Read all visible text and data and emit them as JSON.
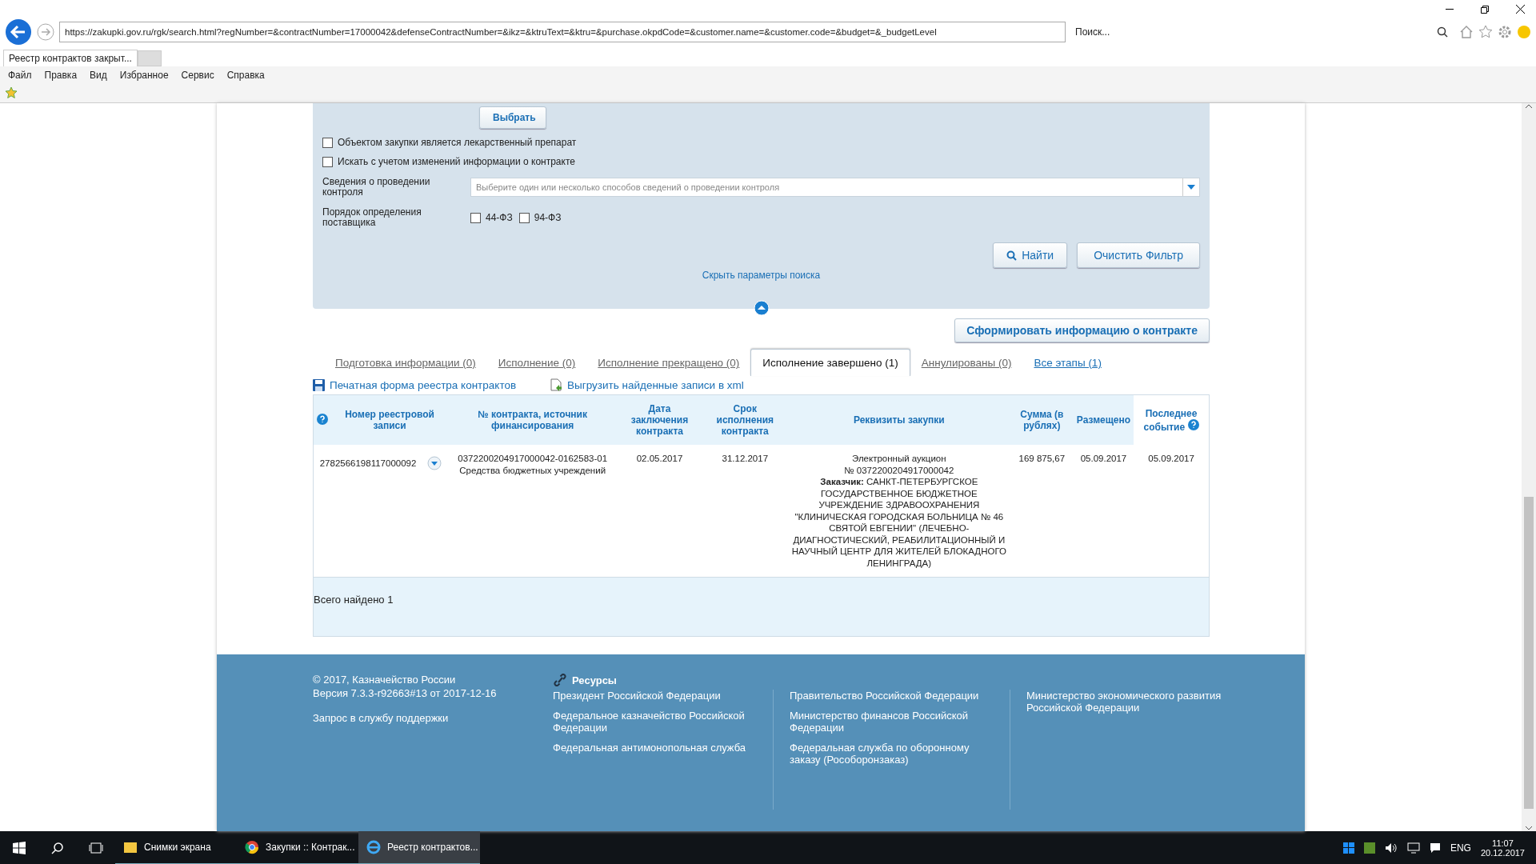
{
  "browser": {
    "url": "https://zakupki.gov.ru/rgk/search.html?regNumber=&contractNumber=17000042&defenseContractNumber=&ikz=&ktruText=&ktru=&purchase.okpdCode=&customer.name=&customer.code=&budget=&_budgetLevel",
    "search_placeholder": "Поиск...",
    "tab_title": "Реестр контрактов закрыт...",
    "menu": [
      "Файл",
      "Правка",
      "Вид",
      "Избранное",
      "Сервис",
      "Справка"
    ]
  },
  "filter": {
    "choose_button": "Выбрать",
    "checkboxes": [
      {
        "label": "Объектом закупки является лекарственный препарат",
        "checked": false
      },
      {
        "label": "Искать с учетом изменений информации о контракте",
        "checked": false
      }
    ],
    "control_label": "Сведения о проведении контроля",
    "control_placeholder": "Выберите один или несколько способов сведений о проведении контроля",
    "supplier_label": "Порядок определения поставщика",
    "supplier_options": [
      {
        "label": "44-ФЗ",
        "checked": false
      },
      {
        "label": "94-ФЗ",
        "checked": false
      }
    ],
    "find_button": "Найти",
    "clear_button": "Очистить Фильтр",
    "hide_link": "Скрыть параметры поиска"
  },
  "generate_button": "Сформировать информацию о контракте",
  "tabs": [
    {
      "label": "Подготовка информации (0)",
      "selected": false,
      "kind": "plain"
    },
    {
      "label": "Исполнение (0)",
      "selected": false,
      "kind": "plain"
    },
    {
      "label": "Исполнение прекращено (0)",
      "selected": false,
      "kind": "plain"
    },
    {
      "label": "Исполнение завершено (1)",
      "selected": true,
      "kind": "plain"
    },
    {
      "label": "Аннулированы (0)",
      "selected": false,
      "kind": "plain"
    },
    {
      "label": "Все этапы (1)",
      "selected": false,
      "kind": "link"
    }
  ],
  "print_link": "Печатная форма реестра контрактов",
  "export_link": "Выгрузить найденные записи в xml",
  "table": {
    "columns": [
      "Номер реестровой записи",
      "№ контракта, источник финансирования",
      "Дата заключения контракта",
      "Срок исполнения контракта",
      "Реквизиты закупки",
      "Сумма (в рублях)",
      "Размещено",
      "Последнее событие"
    ],
    "rows": [
      {
        "reg_number": "2782566198117000092",
        "contract": "0372200204917000042-0162583-01",
        "funding": "Средства бюджетных учреждений",
        "date": "02.05.2017",
        "term": "31.12.2017",
        "purchase": "Электронный аукцион\n№ 0372200204917000042\n**Заказчик:** САНКТ-ПЕТЕРБУРГСКОЕ ГОСУДАРСТВЕННОЕ БЮДЖЕТНОЕ УЧРЕЖДЕНИЕ ЗДРАВООХРАНЕНИЯ \"КЛИНИЧЕСКАЯ ГОРОДСКАЯ БОЛЬНИЦА № 46 СВЯТОЙ ЕВГЕНИИ\" (ЛЕЧЕБНО-ДИАГНОСТИЧЕСКИЙ, РЕАБИЛИТАЦИОННЫЙ И НАУЧНЫЙ ЦЕНТР ДЛЯ ЖИТЕЛЕЙ БЛОКАДНОГО ЛЕНИНГРАДА)",
        "sum": "169 875,67",
        "placed": "05.09.2017",
        "last_event": "05.09.2017"
      }
    ],
    "total": "Всего найдено 1"
  },
  "footer": {
    "copyright": "© 2017, Казначейство России",
    "version": "Версия 7.3.3-r92663#13 от 2017-12-16",
    "support": "Запрос в службу поддержки",
    "resources_title": "Ресурсы",
    "link_columns": [
      [
        "Президент Российской Федерации",
        "Федеральное казначейство Российской Федерации",
        "Федеральная антимонопольная служба"
      ],
      [
        "Правительство Российской Федерации",
        "Министерство финансов Российской Федерации",
        "Федеральная служба по оборонному заказу (Рособоронзаказ)"
      ],
      [
        "Министерство экономического развития Российской Федерации"
      ]
    ]
  },
  "taskbar": {
    "apps": [
      {
        "label": "Снимки экрана",
        "kind": "folder",
        "selected": false
      },
      {
        "label": "Закупки :: Контрак...",
        "kind": "chrome",
        "selected": false
      },
      {
        "label": "Реестр контрактов...",
        "kind": "ie",
        "selected": true
      }
    ],
    "language": "ENG",
    "time": "11:07",
    "date": "20.12.2017"
  }
}
